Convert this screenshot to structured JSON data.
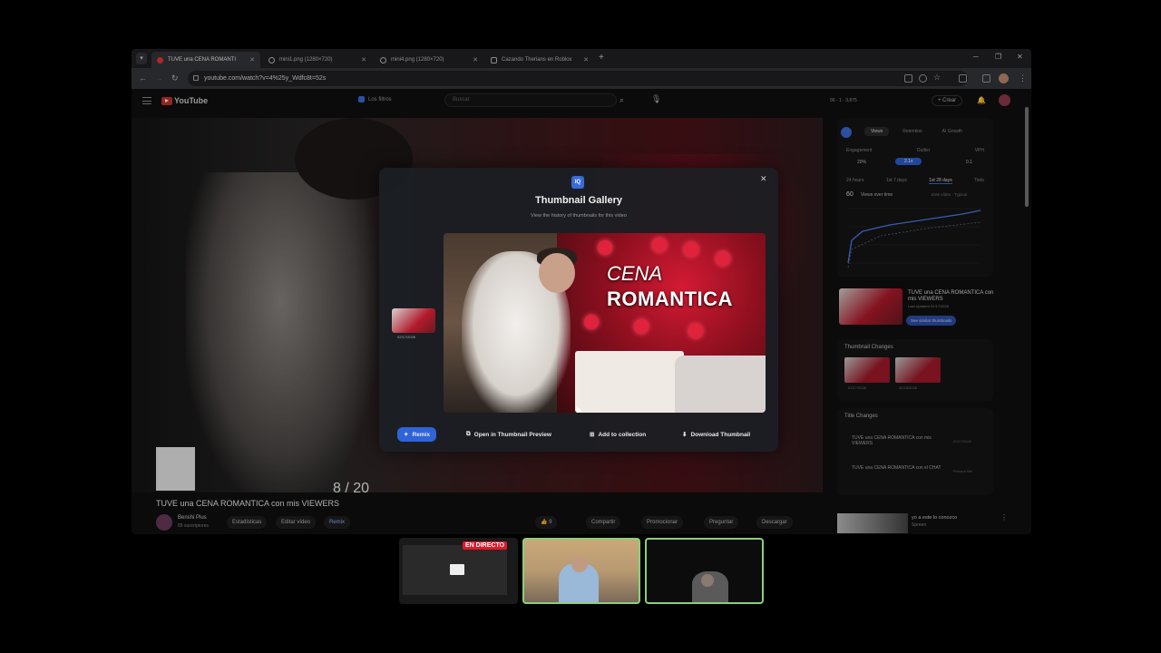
{
  "browser": {
    "tabs": [
      {
        "label": "TUVE una CENA ROMANTI",
        "active": true
      },
      {
        "label": "mini1.png (1280×720)"
      },
      {
        "label": "mini4.png (1280×720)"
      },
      {
        "label": "Cazando Therians en Roblox"
      }
    ],
    "url": "youtube.com/watch?v=4%25y_Wdfc8t=52s"
  },
  "youtube": {
    "logo": "YouTube",
    "filters_label": "Los filtros",
    "search_placeholder": "Buscar",
    "header_stats": "90  ·  1  ·  3,875",
    "create_label": "+ Crear",
    "counter": "8 / 20",
    "video_title": "TUVE una CENA ROMANTICA con mis VIEWERS",
    "channel_name": "Benshi Plus",
    "channel_subs": "85 suscriptores",
    "actions": {
      "stats": "Estadísticas",
      "edit": "Editar vídeo",
      "remix": "Remix",
      "like": "9",
      "share": "Compartir",
      "promote": "Promocionar",
      "ask": "Preguntar",
      "download": "Descargar"
    }
  },
  "sidebar": {
    "tabs": [
      "Views",
      "Retention",
      "AI Growth"
    ],
    "metrics_labels": [
      "Engagement",
      "Outlier",
      "VPH"
    ],
    "metrics_values": [
      "20%",
      "2.1x",
      "0.1"
    ],
    "ranges": [
      "24 hours",
      "1st 7 days",
      "1st 28 days",
      "Todo"
    ],
    "views_count": "60",
    "views_label": "Views over time",
    "legend": "Este vídeo · Typical",
    "card_title": "TUVE una CENA ROMANTICA con mis VIEWERS",
    "card_sub": "Last Updated 02/17/2026",
    "similar_btn": "See similar thumbnails",
    "thumb_changes_title": "Thumbnail Changes",
    "thumb_dates": [
      "02/17/2026",
      "02/15/2026"
    ],
    "title_changes_title": "Title Changes",
    "title_items": [
      {
        "text": "TUVE una CENA ROMANTICA con mis VIEWERS",
        "date": "02/17/2026"
      },
      {
        "text": "TUVE una CENA ROMANTICA con el CHAT",
        "date": "Present title"
      }
    ],
    "rec_title": "yo a este lo conozco",
    "rec_channel": "Spreen"
  },
  "modal": {
    "logo": "IQ",
    "title": "Thumbnail Gallery",
    "subtitle": "View the history of thumbnails for this video",
    "thumb_text_1": "CENA",
    "thumb_text_2": "ROMANTICA",
    "history_date": "02/17/2026",
    "remix": "Remix",
    "open_preview": "Open in Thumbnail Preview",
    "add_collection": "Add to collection",
    "download": "Download Thumbnail"
  },
  "stream": {
    "live_badge": "EN DIRECTO"
  },
  "colors": {
    "accent_blue": "#2f63d8",
    "youtube_red": "#c4302b",
    "live_red": "#e0182a",
    "cam_border": "#8ad07a"
  }
}
